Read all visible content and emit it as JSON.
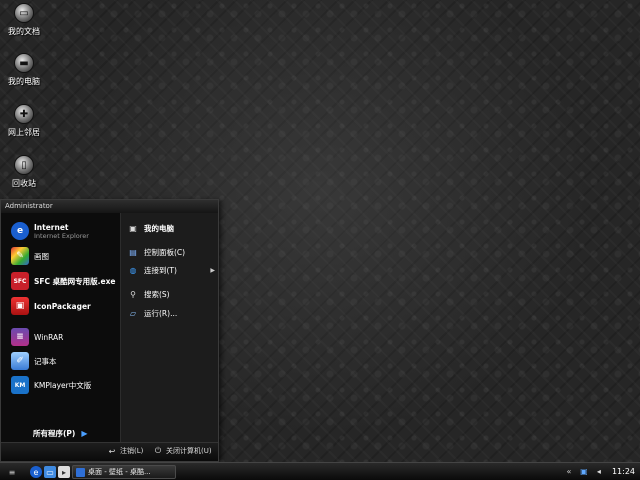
{
  "desktop": {
    "icons": [
      {
        "label": "我的文档",
        "icon": "my-documents-icon"
      },
      {
        "label": "我的电脑",
        "icon": "my-computer-icon"
      },
      {
        "label": "网上邻居",
        "icon": "network-places-icon"
      },
      {
        "label": "回收站",
        "icon": "recycle-bin-icon"
      }
    ]
  },
  "start_menu": {
    "user": "Administrator",
    "pinned": [
      {
        "title": "Internet",
        "subtitle": "Internet Explorer",
        "icon": "internet-explorer-icon"
      },
      {
        "title": "画图",
        "icon": "paint-icon"
      },
      {
        "title": "SFC 桌酷网专用版.exe",
        "icon": "sfc-icon"
      },
      {
        "title": "IconPackager",
        "icon": "iconpackager-icon"
      }
    ],
    "recent": [
      {
        "title": "WinRAR",
        "icon": "winrar-icon"
      },
      {
        "title": "记事本",
        "icon": "notepad-icon"
      },
      {
        "title": "KMPlayer中文版",
        "icon": "kmplayer-icon"
      }
    ],
    "all_programs": "所有程序(P)",
    "right": [
      {
        "label": "我的电脑",
        "icon": "my-computer-icon"
      },
      {
        "label": "控制面板(C)",
        "icon": "control-panel-icon"
      },
      {
        "label": "连接到(T)",
        "icon": "connect-to-icon"
      },
      {
        "label": "搜索(S)",
        "icon": "search-icon"
      },
      {
        "label": "运行(R)...",
        "icon": "run-icon"
      }
    ],
    "logoff": "注销(L)",
    "shutdown": "关闭计算机(U)"
  },
  "taskbar": {
    "task_label": "桌面 - 壁纸 - 桌酷...",
    "clock": "11:24"
  },
  "colors": {
    "menu_bg": "#101010",
    "right_pane_bg": "#1c1c1c",
    "accent_blue": "#2f6fd6"
  }
}
